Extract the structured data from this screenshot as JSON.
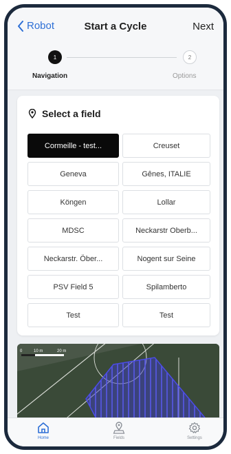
{
  "header": {
    "back_label": "Robot",
    "title": "Start a Cycle",
    "next_label": "Next"
  },
  "stepper": {
    "steps": [
      {
        "number": "1",
        "label": "Navigation",
        "active": true
      },
      {
        "number": "2",
        "label": "Options",
        "active": false
      }
    ]
  },
  "field_select": {
    "title": "Select a field",
    "icon": "location-pin-icon",
    "selected_index": 0,
    "fields": [
      "Cormeille - test...",
      "Creuset",
      "Geneva",
      "Gênes, ITALIE",
      "Köngen",
      "Lollar",
      "MDSC",
      "Neckarstr Oberb...",
      "Neckarstr. Öber...",
      "Nogent sur Seine",
      "PSV Field 5",
      "Spilamberto",
      "Test",
      "Test"
    ]
  },
  "map": {
    "scale_labels": [
      "0",
      "10 m",
      "20 m"
    ]
  },
  "tabbar": {
    "tabs": [
      {
        "label": "Home",
        "icon": "home-icon",
        "active": true
      },
      {
        "label": "Fields",
        "icon": "fields-pin-icon",
        "active": false
      },
      {
        "label": "Settings",
        "icon": "gear-icon",
        "active": false
      }
    ]
  },
  "colors": {
    "accent": "#2d6fd6",
    "selected_field": "#0a0a0a",
    "field_overlay": "#3d3ccf"
  }
}
